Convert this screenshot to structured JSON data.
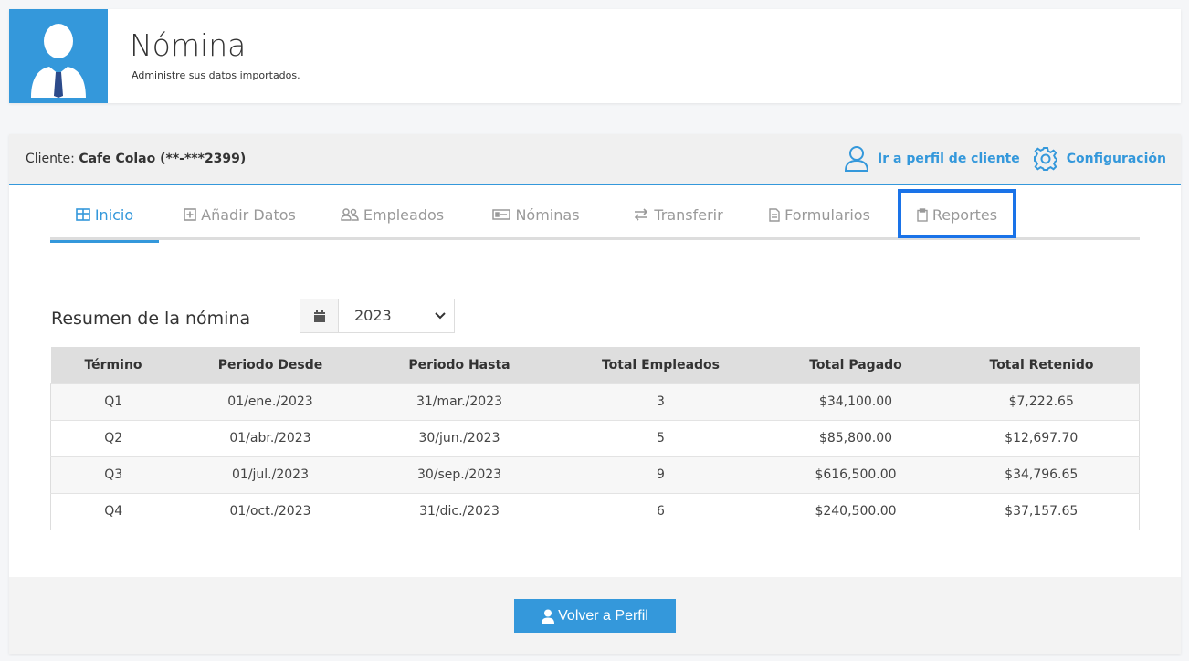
{
  "header": {
    "title": "Nómina",
    "subtitle": "Administre sus datos importados."
  },
  "client": {
    "label": "Cliente: ",
    "name": "Cafe Colao (**-***2399)",
    "profile_link": "Ir a perfil de cliente",
    "settings_link": "Configuración"
  },
  "tabs": [
    {
      "label": "Inicio",
      "icon": "table-icon",
      "active": true
    },
    {
      "label": "Añadir Datos",
      "icon": "plus-square-icon"
    },
    {
      "label": "Empleados",
      "icon": "users-icon"
    },
    {
      "label": "Nóminas",
      "icon": "money-icon"
    },
    {
      "label": "Transferir",
      "icon": "exchange-icon"
    },
    {
      "label": "Formularios",
      "icon": "file-icon"
    },
    {
      "label": "Reportes",
      "icon": "clipboard-icon"
    }
  ],
  "summary": {
    "title": "Resumen de la nómina",
    "year": "2023",
    "columns": [
      "Término",
      "Periodo Desde",
      "Periodo Hasta",
      "Total Empleados",
      "Total Pagado",
      "Total Retenido"
    ],
    "rows": [
      [
        "Q1",
        "01/ene./2023",
        "31/mar./2023",
        "3",
        "$34,100.00",
        "$7,222.65"
      ],
      [
        "Q2",
        "01/abr./2023",
        "30/jun./2023",
        "5",
        "$85,800.00",
        "$12,697.70"
      ],
      [
        "Q3",
        "01/jul./2023",
        "30/sep./2023",
        "9",
        "$616,500.00",
        "$34,796.65"
      ],
      [
        "Q4",
        "01/oct./2023",
        "31/dic./2023",
        "6",
        "$240,500.00",
        "$37,157.65"
      ]
    ]
  },
  "footer": {
    "back_label": "Volver a Perfil"
  },
  "colors": {
    "accent": "#3498db",
    "highlight": "#1a73e8"
  }
}
